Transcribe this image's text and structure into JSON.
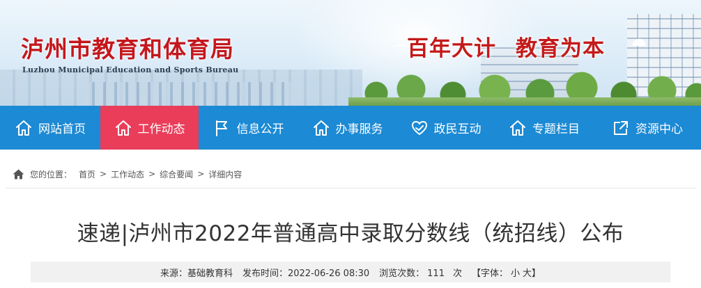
{
  "header": {
    "title": "泸州市教育和体育局",
    "subtitle": "Luzhou Municipal Education and Sports Bureau",
    "slogan_part1": "百年大计",
    "slogan_part2": "教育为本"
  },
  "nav": {
    "items": [
      {
        "label": "网站首页",
        "icon": "home-icon"
      },
      {
        "label": "工作动态",
        "icon": "home-icon",
        "active": true
      },
      {
        "label": "信息公开",
        "icon": "flag-icon"
      },
      {
        "label": "办事服务",
        "icon": "home-icon"
      },
      {
        "label": "政民互动",
        "icon": "heart-hands-icon"
      },
      {
        "label": "专题栏目",
        "icon": "home-icon"
      },
      {
        "label": "资源中心",
        "icon": "share-box-icon"
      }
    ],
    "bg_color": "#1c8ad4",
    "active_color": "#ea3d5a"
  },
  "breadcrumb": {
    "prefix": "您的位置：",
    "items": [
      "首页",
      "工作动态",
      "综合要闻",
      "详细内容"
    ],
    "separator": ">"
  },
  "article": {
    "title": "速递|泸州市2022年普通高中录取分数线（统招线）公布",
    "source_label": "来源：",
    "source": "基础教育科",
    "date_label": "发布时间：",
    "date": "2022-06-26 08:30",
    "views_label": "浏览次数：",
    "views": "111",
    "views_unit": "次",
    "font_label": "【字体：",
    "font_small": "小",
    "font_large": "大",
    "font_close": "】"
  }
}
